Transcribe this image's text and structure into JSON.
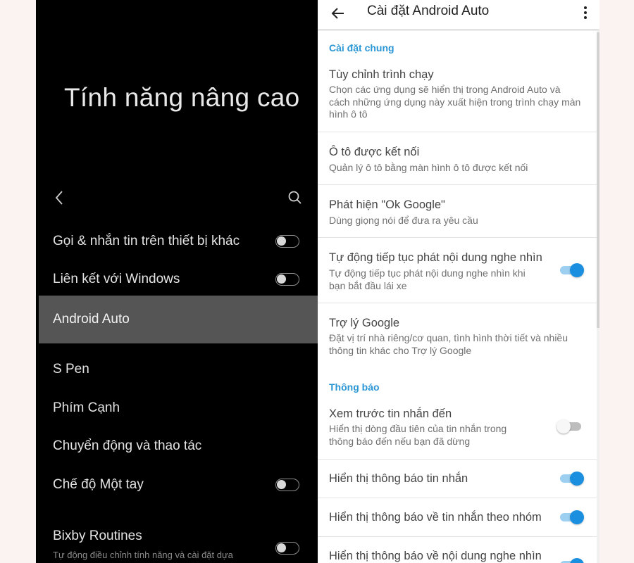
{
  "left_screen": {
    "title": "Tính năng nâng cao",
    "items": [
      {
        "label": "Gọi & nhắn tin trên thiết bị khác",
        "toggle": "off"
      },
      {
        "label": "Liên kết với Windows",
        "toggle": "off"
      },
      {
        "label": "Android Auto",
        "selected": true
      },
      {
        "label": "S Pen"
      },
      {
        "label": "Phím Cạnh"
      },
      {
        "label": "Chuyển động và thao tác"
      },
      {
        "label": "Chế độ Một tay",
        "toggle": "off"
      },
      {
        "label": "Bixby Routines",
        "subtitle": "Tự động điều chỉnh tính năng và cài đặt dựa trên vị trí của bạn và việc bạn đang làm",
        "toggle": "off"
      }
    ]
  },
  "right_screen": {
    "title": "Cài đặt Android Auto",
    "sections": [
      {
        "header": "Cài đặt chung",
        "items": [
          {
            "title": "Tùy chỉnh trình chạy",
            "subtitle": "Chọn các ứng dụng sẽ hiển thị trong Android Auto và cách những ứng dụng này xuất hiện trong trình chạy màn hình ô tô"
          },
          {
            "title": "Ô tô được kết nối",
            "subtitle": "Quản lý ô tô bằng màn hình ô tô được kết nối"
          },
          {
            "title": "Phát hiện \"Ok Google\"",
            "subtitle": "Dùng giọng nói để đưa ra yêu cầu"
          },
          {
            "title": "Tự động tiếp tục phát nội dung nghe nhìn",
            "subtitle": "Tự động tiếp tục phát nội dung nghe nhìn khi bạn bắt đầu lái xe",
            "toggle": "on"
          },
          {
            "title": "Trợ lý Google",
            "subtitle": "Đặt vị trí nhà riêng/cơ quan, tình hình thời tiết và nhiều thông tin khác cho Trợ lý Google"
          }
        ]
      },
      {
        "header": "Thông báo",
        "items": [
          {
            "title": "Xem trước tin nhắn đến",
            "subtitle": "Hiển thị dòng đầu tiên của tin nhắn trong thông báo đến nếu bạn đã dừng",
            "toggle": "off"
          },
          {
            "title": "Hiển thị thông báo tin nhắn",
            "toggle": "on"
          },
          {
            "title": "Hiển thị thông báo về tin nhắn theo nhóm",
            "toggle": "on"
          },
          {
            "title": "Hiển thị thông báo về nội dung nghe nhìn",
            "toggle": "on"
          }
        ]
      }
    ]
  },
  "colors": {
    "accent_blue": "#2b96d5",
    "toggle_on": "#1a8fe0",
    "left_background": "#000000",
    "left_selected": "#555555"
  }
}
